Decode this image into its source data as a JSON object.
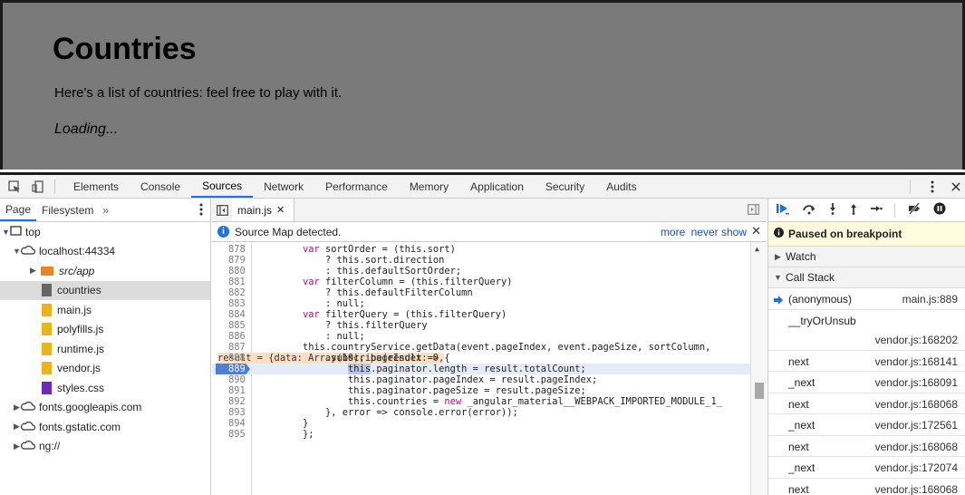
{
  "page": {
    "title": "Countries",
    "subtitle": "Here's a list of countries: feel free to play with it.",
    "loading": "Loading..."
  },
  "devtools": {
    "tabs": [
      "Elements",
      "Console",
      "Sources",
      "Network",
      "Performance",
      "Memory",
      "Application",
      "Security",
      "Audits"
    ],
    "active_tab": "Sources"
  },
  "navigator": {
    "tabs": [
      "Page",
      "Filesystem"
    ],
    "more": "»",
    "tree": [
      {
        "label": "top",
        "kind": "frame"
      },
      {
        "label": "localhost:44334",
        "kind": "cloud"
      },
      {
        "label": "src/app",
        "kind": "folder"
      },
      {
        "label": "countries",
        "kind": "file-gray"
      },
      {
        "label": "main.js",
        "kind": "file"
      },
      {
        "label": "polyfills.js",
        "kind": "file"
      },
      {
        "label": "runtime.js",
        "kind": "file"
      },
      {
        "label": "vendor.js",
        "kind": "file"
      },
      {
        "label": "styles.css",
        "kind": "file-css"
      },
      {
        "label": "fonts.googleapis.com",
        "kind": "cloud"
      },
      {
        "label": "fonts.gstatic.com",
        "kind": "cloud"
      },
      {
        "label": "ng://",
        "kind": "cloud"
      }
    ]
  },
  "editor": {
    "file_tab": "main.js",
    "infobar_text": "Source Map detected.",
    "infobar_more": "more",
    "infobar_never": "never show",
    "current_line": "889",
    "lines": [
      {
        "n": "878",
        "code": "var sortOrder = (this.sort)"
      },
      {
        "n": "879",
        "code": "    ? this.sort.direction"
      },
      {
        "n": "880",
        "code": "    : this.defaultSortOrder;"
      },
      {
        "n": "881",
        "code": "var filterColumn = (this.filterQuery)"
      },
      {
        "n": "882",
        "code": "    ? this.defaultFilterColumn"
      },
      {
        "n": "883",
        "code": "    : null;"
      },
      {
        "n": "884",
        "code": "var filterQuery = (this.filterQuery)"
      },
      {
        "n": "885",
        "code": "    ? this.filterQuery"
      },
      {
        "n": "886",
        "code": "    : null;"
      },
      {
        "n": "887",
        "code": "this.countryService.getData(event.pageIndex, event.pageSize, sortColumn,"
      },
      {
        "n": "888",
        "code": "    .subscribe(result => {",
        "inline": "result = {data: Array(10), pageIndex: 0,"
      },
      {
        "n": "889",
        "code": "        this.paginator.length = result.totalCount;"
      },
      {
        "n": "890",
        "code": "        this.paginator.pageIndex = result.pageIndex;"
      },
      {
        "n": "891",
        "code": "        this.paginator.pageSize = result.pageSize;"
      },
      {
        "n": "892",
        "code": "        this.countries = new _angular_material__WEBPACK_IMPORTED_MODULE_1_"
      },
      {
        "n": "893",
        "code": "    }, error => console.error(error));"
      },
      {
        "n": "894",
        "code": "}"
      },
      {
        "n": "895",
        "code": "};"
      }
    ]
  },
  "debugger": {
    "paused": "Paused on breakpoint",
    "watch": "Watch",
    "call_stack": "Call Stack",
    "frames": [
      {
        "name": "(anonymous)",
        "loc": "main.js:889",
        "selected": true
      },
      {
        "name": "__tryOrUnsub",
        "loc": "vendor.js:168202",
        "tall": true
      },
      {
        "name": "next",
        "loc": "vendor.js:168141"
      },
      {
        "name": "_next",
        "loc": "vendor.js:168091"
      },
      {
        "name": "next",
        "loc": "vendor.js:168068"
      },
      {
        "name": "_next",
        "loc": "vendor.js:172561"
      },
      {
        "name": "next",
        "loc": "vendor.js:168068"
      },
      {
        "name": "_next",
        "loc": "vendor.js:172074"
      },
      {
        "name": "next",
        "loc": "vendor.js:168068"
      }
    ]
  },
  "colors": {
    "accent": "#1a73e8",
    "breakpoint": "#4d7fd8",
    "paused_bg": "#fffbdc",
    "keyword": "#aa0d91"
  }
}
